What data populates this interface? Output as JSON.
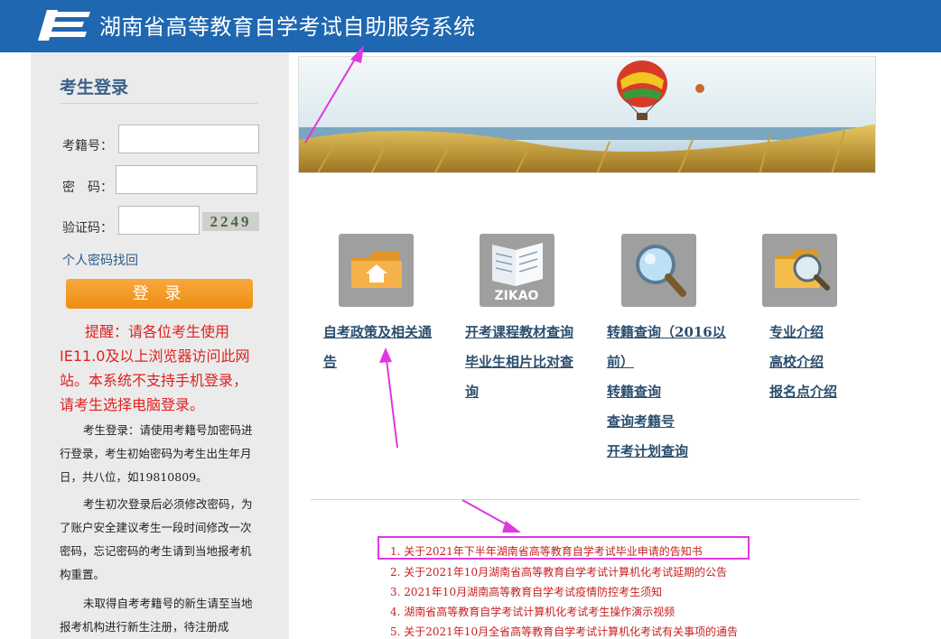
{
  "header": {
    "title": "湖南省高等教育自学考试自助服务系统"
  },
  "login": {
    "title": "考生登录",
    "fields": [
      {
        "label": "考籍号：",
        "value": ""
      },
      {
        "label": "密　码：",
        "value": ""
      },
      {
        "label": "验证码：",
        "value": ""
      }
    ],
    "captcha_text": "2249",
    "recover_link": "个人密码找回",
    "submit_label": "登 录",
    "warning": "提醒：请各位考生使用IE11.0及以上浏览器访问此网站。本系统不支持手机登录，请考生选择电脑登录。",
    "notes": [
      "考生登录：请使用考籍号加密码进行登录，考生初始密码为考生出生年月日，共八位，如19810809。",
      "考生初次登录后必须修改密码，为了账户安全建议考生一段时间修改一次密码，忘记密码的考生请到当地报考机构重置。",
      "未取得自考考籍号的新生请至当地报考机构进行新生注册，待注册成"
    ]
  },
  "quick_links": [
    {
      "icon": "folder-home-icon",
      "links": [
        "自考政策及相关通",
        "告"
      ]
    },
    {
      "icon": "zikao-book-icon",
      "icon_text": "ZIKAO",
      "links": [
        "开考课程教材查询",
        "毕业生相片比对查",
        "询"
      ]
    },
    {
      "icon": "magnifier-icon",
      "links": [
        "转籍查询（2016以",
        "前）",
        "转籍查询",
        "查询考籍号",
        "开考计划查询"
      ]
    },
    {
      "icon": "folder-search-icon",
      "links": [
        "专业介绍",
        "高校介绍",
        "报名点介绍"
      ]
    }
  ],
  "notices": [
    "1. 关于2021年下半年湖南省高等教育自学考试毕业申请的告知书",
    "2. 关于2021年10月湖南省高等教育自学考试计算机化考试延期的公告",
    "3. 2021年10月湖南高等教育自学考试疫情防控考生须知",
    "4. 湖南省高等教育自学考试计算机化考试考生操作演示视频",
    "5. 关于2021年10月全省高等教育自学考试计算机化考试有关事项的通告"
  ],
  "colors": {
    "header": "#1f67b0",
    "warning": "#e02020",
    "notice": "#c82020",
    "link": "#2a4e6e",
    "annotation": "#e038e0"
  }
}
